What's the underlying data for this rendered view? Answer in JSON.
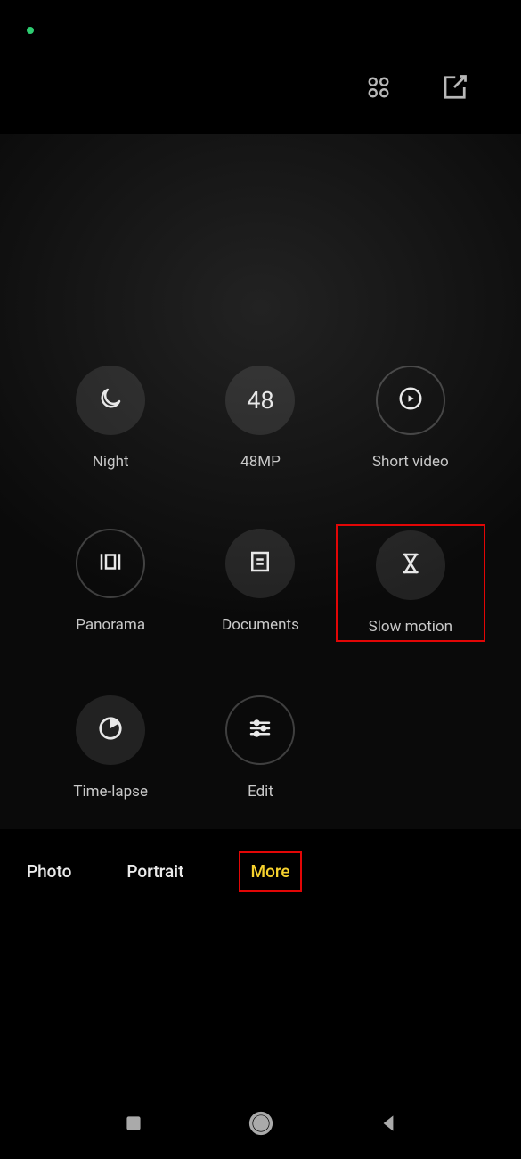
{
  "modes": {
    "night": "Night",
    "mp48": "48MP",
    "mp48_digits": "48",
    "short_video": "Short video",
    "panorama": "Panorama",
    "documents": "Documents",
    "slow_motion": "Slow motion",
    "time_lapse": "Time-lapse",
    "edit": "Edit"
  },
  "tabs": {
    "photo": "Photo",
    "portrait": "Portrait",
    "more": "More"
  }
}
